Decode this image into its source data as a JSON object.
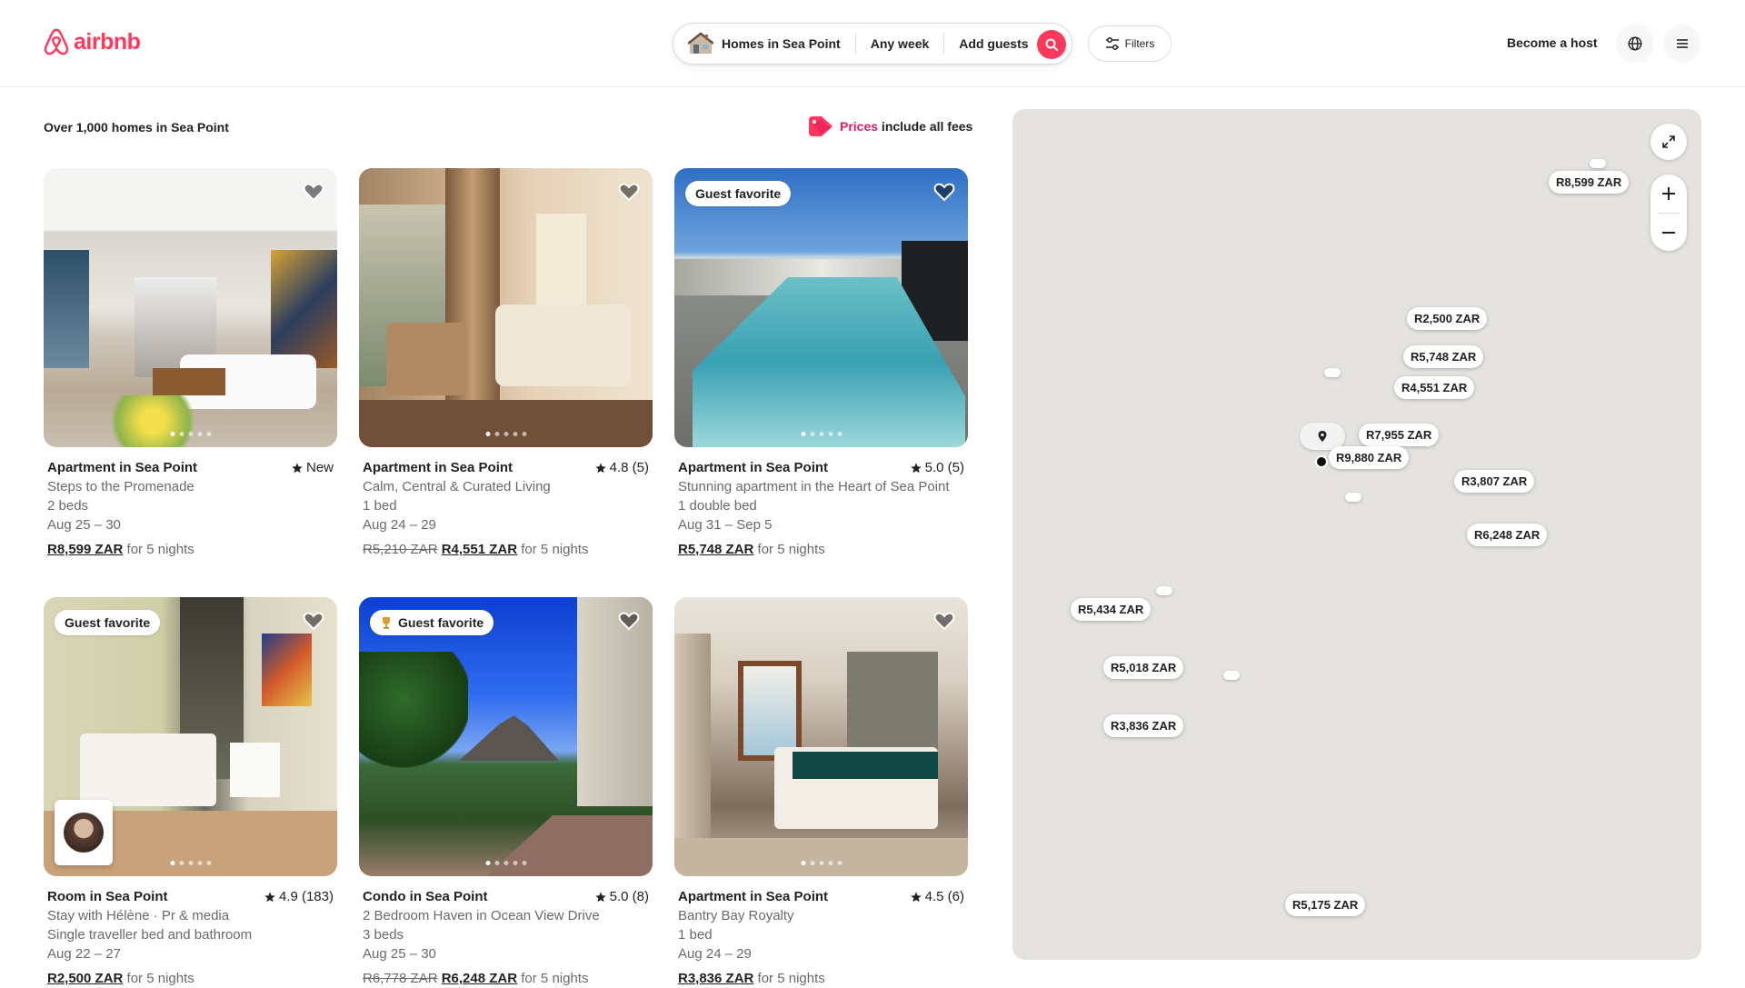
{
  "header": {
    "logo_text": "airbnb",
    "search": {
      "location": "Homes in Sea Point",
      "dates": "Any week",
      "guests": "Add guests"
    },
    "filters_label": "Filters",
    "become_host": "Become a host"
  },
  "results": {
    "count_text": "Over 1,000 homes in Sea Point",
    "fees_prices": "Prices",
    "fees_rest": " include all fees"
  },
  "listings": [
    {
      "title": "Apartment in Sea Point",
      "rating": "New",
      "description": "Steps to the Promenade",
      "beds": "2 beds",
      "dates": "Aug 25 – 30",
      "old_price": "",
      "price": "R8,599 ZAR",
      "suffix": " for 5 nights",
      "badge": ""
    },
    {
      "title": "Apartment in Sea Point",
      "rating": "4.8 (5)",
      "description": "Calm, Central & Curated Living",
      "beds": "1 bed",
      "dates": "Aug 24 – 29",
      "old_price": "R5,210 ZAR",
      "price": "R4,551 ZAR",
      "suffix": " for 5 nights",
      "badge": ""
    },
    {
      "title": "Apartment in Sea Point",
      "rating": "5.0 (5)",
      "description": "Stunning apartment in the Heart of Sea Point",
      "beds": "1 double bed",
      "dates": "Aug 31 – Sep 5",
      "old_price": "",
      "price": "R5,748 ZAR",
      "suffix": " for 5 nights",
      "badge": "Guest favorite"
    },
    {
      "title": "Room in Sea Point",
      "rating": "4.9 (183)",
      "description": "Stay with Hélène · Pr & media",
      "beds": "Single traveller bed and bathroom",
      "dates": "Aug 22 – 27",
      "old_price": "",
      "price": "R2,500 ZAR",
      "suffix": " for 5 nights",
      "badge": "Guest favorite"
    },
    {
      "title": "Condo in Sea Point",
      "rating": "5.0 (8)",
      "description": "2 Bedroom Haven in Ocean View Drive",
      "beds": "3 beds",
      "dates": "Aug 25 – 30",
      "old_price": "R6,778 ZAR",
      "price": "R6,248 ZAR",
      "suffix": " for 5 nights",
      "badge": "Guest favorite"
    },
    {
      "title": "Apartment in Sea Point",
      "rating": "4.5 (6)",
      "description": "Bantry Bay Royalty",
      "beds": "1 bed",
      "dates": "Aug 24 – 29",
      "old_price": "",
      "price": "R3,836 ZAR",
      "suffix": " for 5 nights",
      "badge": ""
    }
  ],
  "map": {
    "pins": [
      "R8,599 ZAR",
      "R2,500 ZAR",
      "R5,748 ZAR",
      "R4,551 ZAR",
      "R7,955 ZAR",
      "R9,880 ZAR",
      "R3,807 ZAR",
      "R6,248 ZAR",
      "R5,434 ZAR",
      "R5,018 ZAR",
      "R3,836 ZAR",
      "R5,175 ZAR"
    ]
  },
  "colors": {
    "brand": "#ff385c",
    "map_bg": "#e5e3df"
  }
}
